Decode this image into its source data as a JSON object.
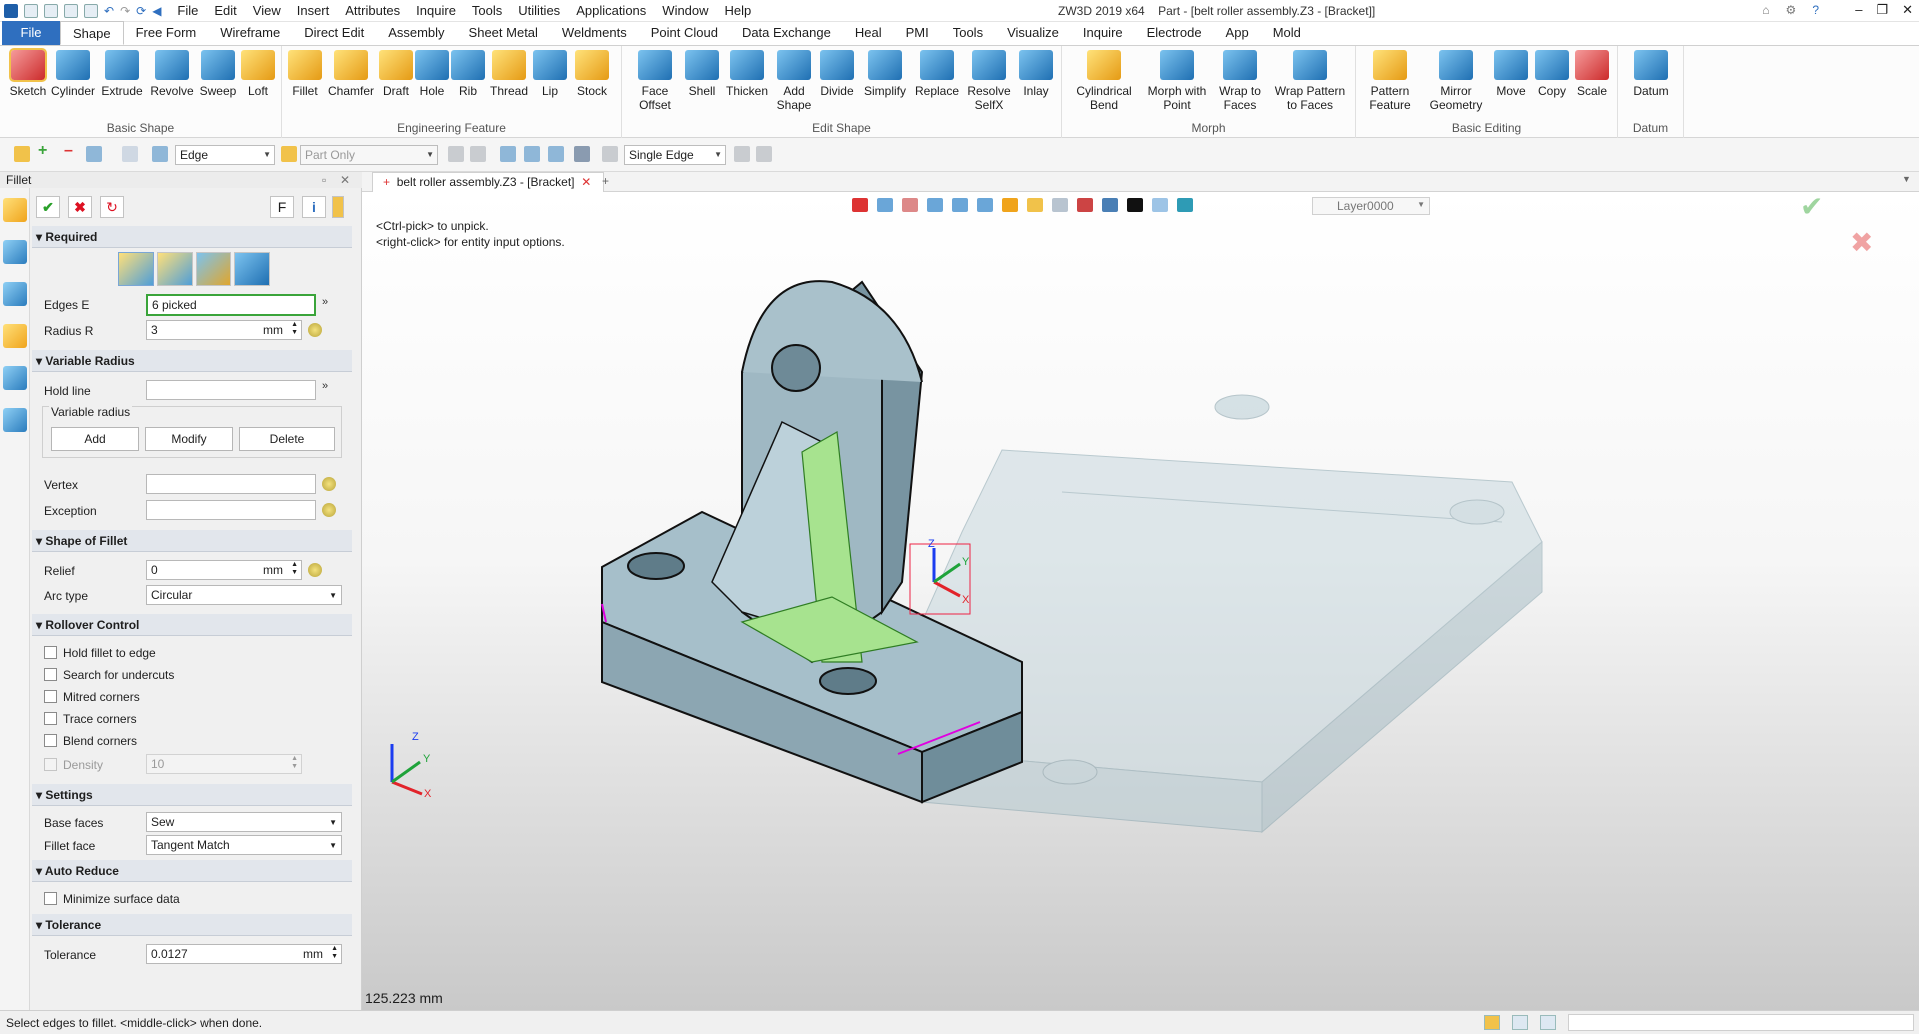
{
  "titlebar": {
    "app_title": "ZW3D 2019  x64",
    "doc_title": "Part - [belt roller assembly.Z3 - [Bracket]]",
    "menu": [
      "File",
      "Edit",
      "View",
      "Insert",
      "Attributes",
      "Inquire",
      "Tools",
      "Utilities",
      "Applications",
      "Window",
      "Help"
    ]
  },
  "ribbon_tabs": [
    "File",
    "Shape",
    "Free Form",
    "Wireframe",
    "Direct Edit",
    "Assembly",
    "Sheet Metal",
    "Weldments",
    "Point Cloud",
    "Data Exchange",
    "Heal",
    "PMI",
    "Tools",
    "Visualize",
    "Inquire",
    "Electrode",
    "App",
    "Mold"
  ],
  "ribbon": {
    "basic_shape": {
      "label": "Basic Shape",
      "tools": [
        "Sketch",
        "Cylinder",
        "Extrude",
        "Revolve",
        "Sweep",
        "Loft"
      ]
    },
    "engineering": {
      "label": "Engineering Feature",
      "tools": [
        "Fillet",
        "Chamfer",
        "Draft",
        "Hole",
        "Rib",
        "Thread",
        "Lip",
        "Stock"
      ]
    },
    "edit_shape": {
      "label": "Edit Shape",
      "tools": [
        "Face Offset",
        "Shell",
        "Thicken",
        "Add Shape",
        "Divide",
        "Simplify",
        "Replace",
        "Resolve SelfX",
        "Inlay"
      ]
    },
    "morph": {
      "label": "Morph",
      "tools": [
        "Cylindrical Bend",
        "Morph with Point",
        "Wrap to Faces",
        "Wrap Pattern to Faces"
      ]
    },
    "basic_editing": {
      "label": "Basic Editing",
      "tools": [
        "Pattern Feature",
        "Mirror Geometry",
        "Move",
        "Copy",
        "Scale"
      ]
    },
    "datum": {
      "label": "Datum",
      "tools": [
        "Datum"
      ]
    }
  },
  "cmdbar": {
    "filter": "Edge",
    "scope": "Part Only",
    "pick_mode": "Single Edge"
  },
  "panel": {
    "title": "Fillet",
    "f_button": "F",
    "required": {
      "header": "Required",
      "edges_label": "Edges E",
      "edges_value": "6 picked",
      "radius_label": "Radius R",
      "radius_value": "3",
      "radius_unit": "mm"
    },
    "variable_radius": {
      "header": "Variable Radius",
      "hold_line_label": "Hold line",
      "group_label": "Variable radius",
      "add": "Add",
      "modify": "Modify",
      "delete": "Delete",
      "vertex_label": "Vertex",
      "exception_label": "Exception"
    },
    "shape_of_fillet": {
      "header": "Shape of Fillet",
      "relief_label": "Relief",
      "relief_value": "0",
      "relief_unit": "mm",
      "arc_type_label": "Arc type",
      "arc_type_value": "Circular"
    },
    "rollover": {
      "header": "Rollover Control",
      "options": [
        "Hold fillet to edge",
        "Search for undercuts",
        "Mitred corners",
        "Trace corners",
        "Blend corners"
      ],
      "density_label": "Density",
      "density_value": "10"
    },
    "settings": {
      "header": "Settings",
      "base_faces_label": "Base faces",
      "base_faces_value": "Sew",
      "fillet_face_label": "Fillet face",
      "fillet_face_value": "Tangent Match"
    },
    "auto_reduce": {
      "header": "Auto Reduce",
      "option": "Minimize surface data"
    },
    "tolerance": {
      "header": "Tolerance",
      "label": "Tolerance",
      "value": "0.0127",
      "unit": "mm"
    }
  },
  "viewport": {
    "tab": "belt roller assembly.Z3 - [Bracket]",
    "layer": "Layer0000",
    "hint1": "<Ctrl-pick> to unpick.",
    "hint2": "<right-click> for entity input options.",
    "measure": "125.223 mm",
    "axis": {
      "x": "X",
      "y": "Y",
      "z": "Z"
    }
  },
  "status": {
    "text": "Select edges to fillet.  <middle-click> when done."
  }
}
